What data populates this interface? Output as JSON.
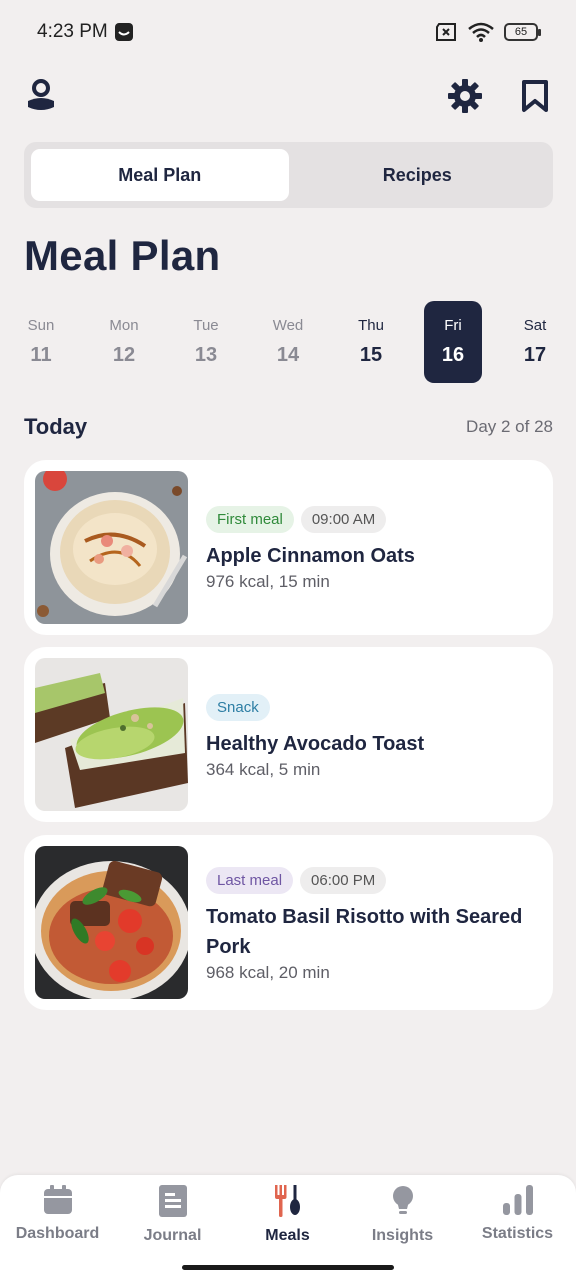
{
  "status_bar": {
    "time": "4:23 PM",
    "battery": "65"
  },
  "segments": [
    {
      "label": "Meal Plan",
      "active": true
    },
    {
      "label": "Recipes",
      "active": false
    }
  ],
  "page_title": "Meal Plan",
  "week": [
    {
      "name": "Sun",
      "num": "11"
    },
    {
      "name": "Mon",
      "num": "12"
    },
    {
      "name": "Tue",
      "num": "13"
    },
    {
      "name": "Wed",
      "num": "14"
    },
    {
      "name": "Thu",
      "num": "15"
    },
    {
      "name": "Fri",
      "num": "16"
    },
    {
      "name": "Sat",
      "num": "17"
    }
  ],
  "today": {
    "label": "Today",
    "progress": "Day 2 of 28"
  },
  "meals": [
    {
      "tag": "First meal",
      "time": "09:00 AM",
      "title": "Apple Cinnamon Oats",
      "meta": "976 kcal, 15 min"
    },
    {
      "tag": "Snack",
      "title": "Healthy Avocado Toast",
      "meta": "364 kcal, 5 min"
    },
    {
      "tag": "Last meal",
      "time": "06:00 PM",
      "title": "Tomato Basil Risotto with Seared Pork",
      "meta": "968 kcal, 20 min"
    }
  ],
  "bottom_nav": [
    {
      "label": "Dashboard",
      "icon": "calendar-icon"
    },
    {
      "label": "Journal",
      "icon": "journal-icon"
    },
    {
      "label": "Meals",
      "icon": "fork-spoon-icon",
      "active": true
    },
    {
      "label": "Insights",
      "icon": "lightbulb-icon"
    },
    {
      "label": "Statistics",
      "icon": "bar-chart-icon"
    }
  ],
  "colors": {
    "primary": "#1f2640",
    "background": "#f2efef",
    "accent": "#e0654f"
  }
}
